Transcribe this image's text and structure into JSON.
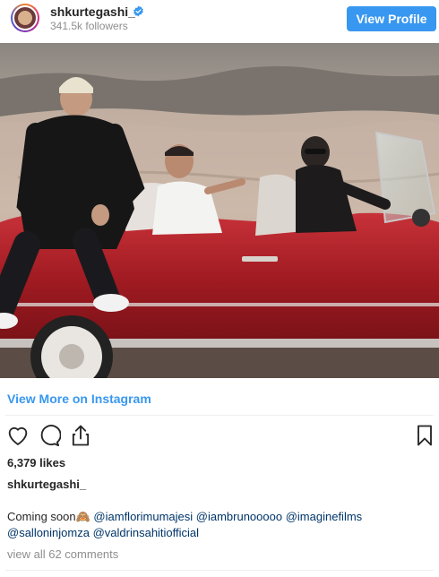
{
  "header": {
    "username": "shkurtegashi_",
    "followers": "341.5k followers",
    "view_profile_label": "View Profile"
  },
  "post": {
    "view_more_label": "View More on Instagram",
    "likes": "6,379 likes",
    "caption_user": "shkurtegashi_",
    "caption_text": "Coming soon🙈",
    "mentions": [
      "@iamflorimumajesi",
      "@iambrunooooo",
      "@imaginefilms",
      "@salloninjomza",
      "@valdrinsahitiofficial"
    ],
    "comments_label": "view all 62 comments"
  },
  "colors": {
    "accent": "#3897f0",
    "link": "#003569",
    "muted": "#8e8e8e",
    "car": "#a11b22"
  },
  "icons": {
    "verified": "verified-badge-icon",
    "like": "heart-icon",
    "comment": "comment-icon",
    "share": "share-icon",
    "save": "bookmark-icon"
  }
}
